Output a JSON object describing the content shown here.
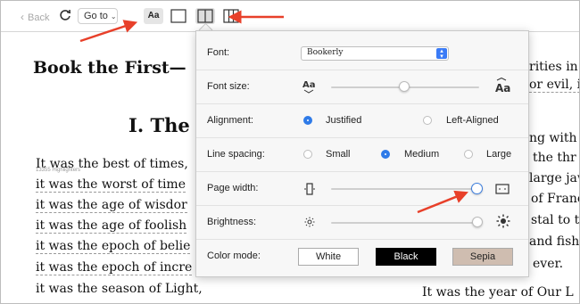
{
  "toolbar": {
    "back_label": "Back",
    "goto_label": "Go to",
    "font_button_label": "Aa"
  },
  "book": {
    "chapter_title": "Book the First—",
    "section_title": "I. The",
    "highlight_note": "13355 Highlighters",
    "left_lines": [
      "It was the best of times,",
      "it was the worst of time",
      "it was the age of wisdor",
      "it was the age of foolish",
      "it was the epoch of belie",
      "it was the epoch of incre",
      "it was the season of Light,"
    ],
    "right_lines": [
      "rities in",
      "or evil, in",
      "ng with",
      "the thr",
      "large jaw",
      "of France",
      "stal to th",
      "and fisho",
      "ever.",
      "It was the year of Our L"
    ]
  },
  "settings": {
    "font": {
      "label": "Font:",
      "value": "Bookerly"
    },
    "font_size": {
      "label": "Font size:",
      "level": 0.5
    },
    "alignment": {
      "label": "Alignment:",
      "options": [
        "Justified",
        "Left-Aligned"
      ],
      "selected": "Justified"
    },
    "line_spacing": {
      "label": "Line spacing:",
      "options": [
        "Small",
        "Medium",
        "Large"
      ],
      "selected": "Medium"
    },
    "page_width": {
      "label": "Page width:",
      "level": 0.98
    },
    "brightness": {
      "label": "Brightness:",
      "level": 1.0
    },
    "color_mode": {
      "label": "Color mode:",
      "options": [
        "White",
        "Black",
        "Sepia"
      ]
    }
  },
  "colors": {
    "accent": "#2f7be8",
    "arrow": "#e8402a",
    "sepia": "#cfbdb0"
  }
}
